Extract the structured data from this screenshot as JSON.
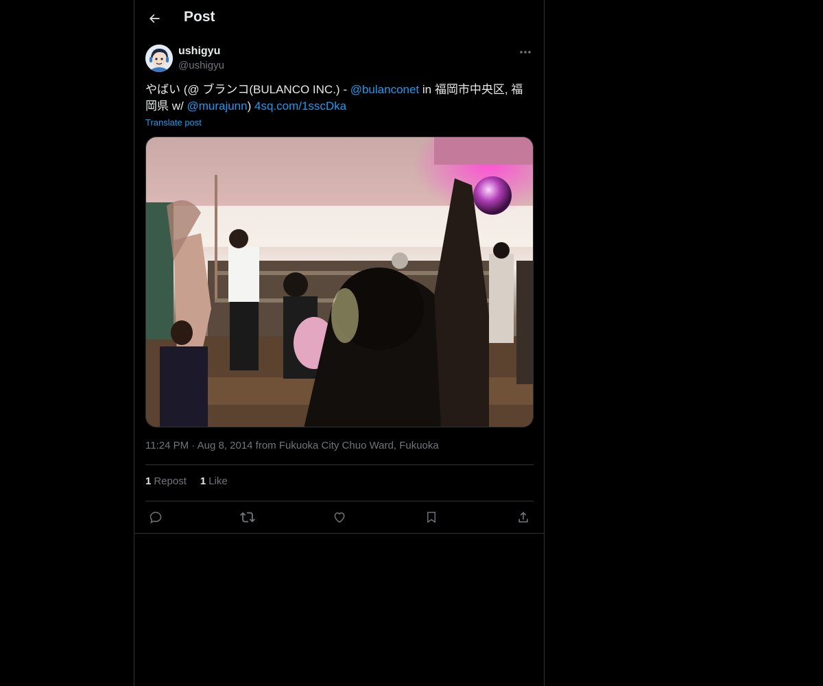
{
  "header": {
    "title": "Post",
    "back_icon": "arrow-left-icon"
  },
  "author": {
    "name": "ushigyu",
    "handle": "@ushigyu",
    "avatar": "cartoon-avatar-image",
    "more_icon": "more-horizontal-icon"
  },
  "post": {
    "text_part1": "やばい (@ ブランコ(BULANCO INC.) - ",
    "mention1": "@bulanconet",
    "text_part2": " in 福岡市中央区, 福岡県 w/ ",
    "mention2": "@murajunn",
    "text_part3": ") ",
    "link": "4sq.com/1sscDka",
    "translate_label": "Translate post",
    "photo": "party-photo-disco-ball-crowd"
  },
  "meta": {
    "time": "11:24 PM",
    "separator": "·",
    "date_location": "Aug 8, 2014 from Fukuoka City Chuo Ward, Fukuoka"
  },
  "stats": {
    "reposts_count": "1",
    "reposts_label": "Repost",
    "likes_count": "1",
    "likes_label": "Like"
  },
  "actions": [
    "reply-icon",
    "repost-icon",
    "like-icon",
    "bookmark-icon",
    "share-icon"
  ],
  "colors": {
    "background": "#000000",
    "text": "#e7e9ea",
    "muted": "#71767b",
    "accent": "#1d9bf0",
    "border": "#2f3336"
  }
}
